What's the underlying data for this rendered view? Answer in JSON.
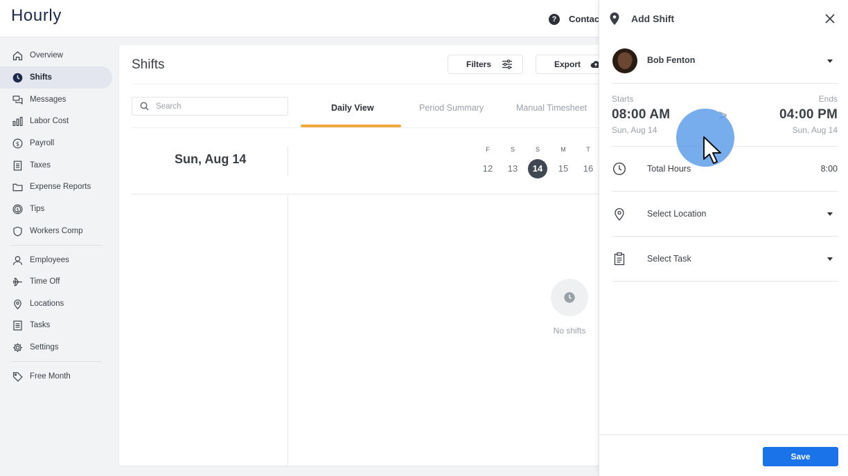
{
  "app": {
    "logo": "Hourly"
  },
  "topbar": {
    "help_glyph": "?",
    "contact_label": "Contact"
  },
  "sidebar": {
    "items": [
      {
        "label": "Overview",
        "icon": "home-icon"
      },
      {
        "label": "Shifts",
        "icon": "clock-icon",
        "active": true
      },
      {
        "label": "Messages",
        "icon": "messages-icon"
      },
      {
        "label": "Labor Cost",
        "icon": "bar-chart-icon"
      },
      {
        "label": "Payroll",
        "icon": "dollar-icon"
      },
      {
        "label": "Taxes",
        "icon": "document-icon"
      },
      {
        "label": "Expense Reports",
        "icon": "folder-icon"
      },
      {
        "label": "Tips",
        "icon": "coin-icon"
      },
      {
        "label": "Workers Comp",
        "icon": "shield-icon"
      },
      {
        "label": "Employees",
        "icon": "person-icon"
      },
      {
        "label": "Time Off",
        "icon": "plane-icon"
      },
      {
        "label": "Locations",
        "icon": "location-pin-icon"
      },
      {
        "label": "Tasks",
        "icon": "list-icon"
      },
      {
        "label": "Settings",
        "icon": "gear-icon"
      },
      {
        "label": "Free Month",
        "icon": "tag-icon"
      }
    ]
  },
  "main": {
    "title": "Shifts",
    "filters_label": "Filters",
    "export_label": "Export",
    "search_placeholder": "Search",
    "tabs": [
      {
        "label": "Daily View",
        "active": true
      },
      {
        "label": "Period Summary"
      },
      {
        "label": "Manual Timesheet"
      }
    ],
    "date_heading": "Sun, Aug 14",
    "week": [
      {
        "letter": "F",
        "num": "12"
      },
      {
        "letter": "S",
        "num": "13"
      },
      {
        "letter": "S",
        "num": "14",
        "selected": true
      },
      {
        "letter": "M",
        "num": "15"
      },
      {
        "letter": "T",
        "num": "16"
      }
    ],
    "empty_text": "No shifts"
  },
  "panel": {
    "title": "Add Shift",
    "employee_name": "Bob Fenton",
    "starts_label": "Starts",
    "ends_label": "Ends",
    "start_time": "08:00 AM",
    "end_time": "04:00 PM",
    "start_date": "Sun, Aug 14",
    "end_date": "Sun, Aug 14",
    "arrow": ">",
    "total_hours_label": "Total Hours",
    "total_hours_value": "8:00",
    "location_placeholder": "Select Location",
    "task_placeholder": "Select Task",
    "save_label": "Save"
  },
  "colors": {
    "accent_blue": "#1a73e8",
    "tab_underline": "#f2a93b",
    "active_nav_bg": "#e3e6ee",
    "cursor_halo": "#5698e8"
  }
}
